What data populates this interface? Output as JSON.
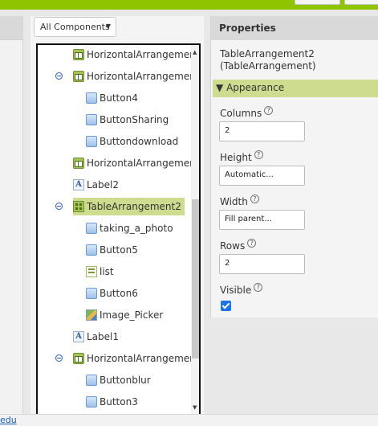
{
  "components": {
    "dropdown_label": "All Components",
    "tree": [
      {
        "name": "HorizontalArrangement",
        "icon": "horizontal-arrangement-icon",
        "level": 0
      },
      {
        "name": "HorizontalArrangement",
        "icon": "horizontal-arrangement-icon",
        "level": 0,
        "expanded": true
      },
      {
        "name": "Button4",
        "icon": "button-icon",
        "level": 1
      },
      {
        "name": "ButtonSharing",
        "icon": "button-icon",
        "level": 1
      },
      {
        "name": "Buttondownload",
        "icon": "button-icon",
        "level": 1
      },
      {
        "name": "HorizontalArrangement",
        "icon": "horizontal-arrangement-icon",
        "level": 0
      },
      {
        "name": "Label2",
        "icon": "label-icon",
        "level": 0
      },
      {
        "name": "TableArrangement2",
        "icon": "table-arrangement-icon",
        "level": 0,
        "expanded": true,
        "selected": true
      },
      {
        "name": "taking_a_photo",
        "icon": "button-icon",
        "level": 1
      },
      {
        "name": "Button5",
        "icon": "button-icon",
        "level": 1
      },
      {
        "name": "list",
        "icon": "list-view-icon",
        "level": 1
      },
      {
        "name": "Button6",
        "icon": "button-icon",
        "level": 1
      },
      {
        "name": "Image_Picker",
        "icon": "image-picker-icon",
        "level": 1
      },
      {
        "name": "Label1",
        "icon": "label-icon",
        "level": 0
      },
      {
        "name": "HorizontalArrangement",
        "icon": "horizontal-arrangement-icon",
        "level": 0,
        "expanded": true
      },
      {
        "name": "Buttonblur",
        "icon": "button-icon",
        "level": 1
      },
      {
        "name": "Button3",
        "icon": "button-icon",
        "level": 1
      }
    ]
  },
  "properties": {
    "header": "Properties",
    "component_name_line1": "TableArrangement2",
    "component_name_line2": "(TableArrangement)",
    "section": "Appearance",
    "section_arrow": "▼",
    "help_glyph": "?",
    "columns": {
      "label": "Columns",
      "value": "2"
    },
    "height": {
      "label": "Height",
      "value": "Automatic..."
    },
    "width": {
      "label": "Width",
      "value": "Fill parent..."
    },
    "rows": {
      "label": "Rows",
      "value": "2"
    },
    "visible": {
      "label": "Visible",
      "checked": true
    }
  },
  "footer": {
    "link_text": "edu"
  },
  "colors": {
    "accent_green": "#8fc400",
    "selection": "#cddc8e",
    "checkbox": "#1a73e8"
  }
}
